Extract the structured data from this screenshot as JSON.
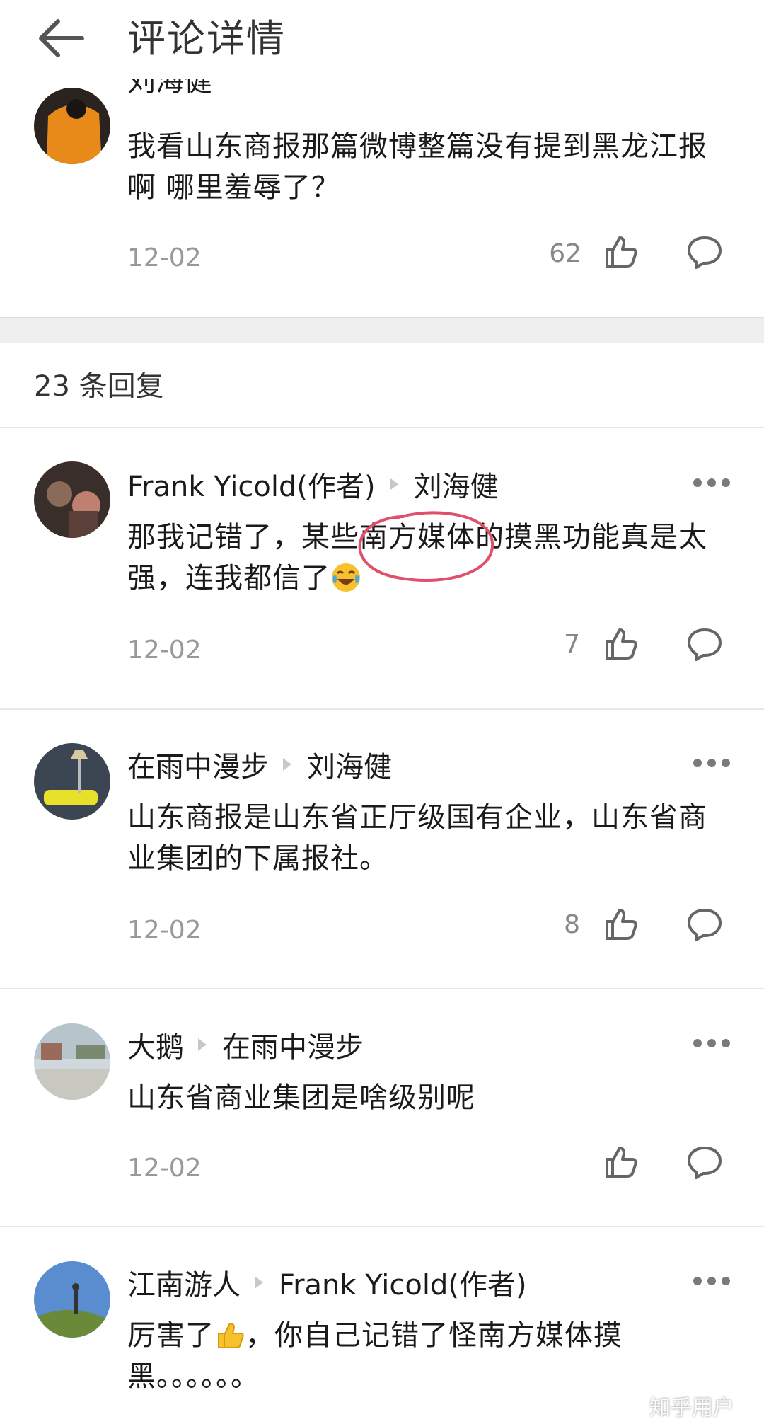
{
  "header": {
    "title": "评论详情"
  },
  "main_comment": {
    "author": "刘海健",
    "text": "我看山东商报那篇微博整篇没有提到黑龙江报啊 哪里羞辱了？",
    "date": "12-02",
    "likes": "62"
  },
  "reply_count": "23 条回复",
  "replies": [
    {
      "author": "Frank Yicold(作者)",
      "reply_to": "刘海健",
      "text": "那我记错了，某些南方媒体的摸黑功能真是太强，连我都信了",
      "emoji": "laughing-crying-emoji",
      "date": "12-02",
      "likes": "7"
    },
    {
      "author": "在雨中漫步",
      "reply_to": "刘海健",
      "text": "山东商报是山东省正厅级国有企业，山东省商业集团的下属报社。",
      "date": "12-02",
      "likes": "8"
    },
    {
      "author": "大鹅",
      "reply_to": "在雨中漫步",
      "text": "山东省商业集团是啥级别呢",
      "date": "12-02",
      "likes": ""
    },
    {
      "author": "江南游人",
      "reply_to": "Frank Yicold(作者)",
      "text_before": "厉害了",
      "emoji": "thumbs-up-emoji",
      "text_after": "，你自己记错了怪南方媒体摸黑。。。。。。"
    }
  ],
  "watermark": "知乎用户",
  "colors": {
    "text": "#1a1a1a",
    "secondary": "#999999",
    "divider": "#efefef",
    "annotation": "#e0506a"
  }
}
